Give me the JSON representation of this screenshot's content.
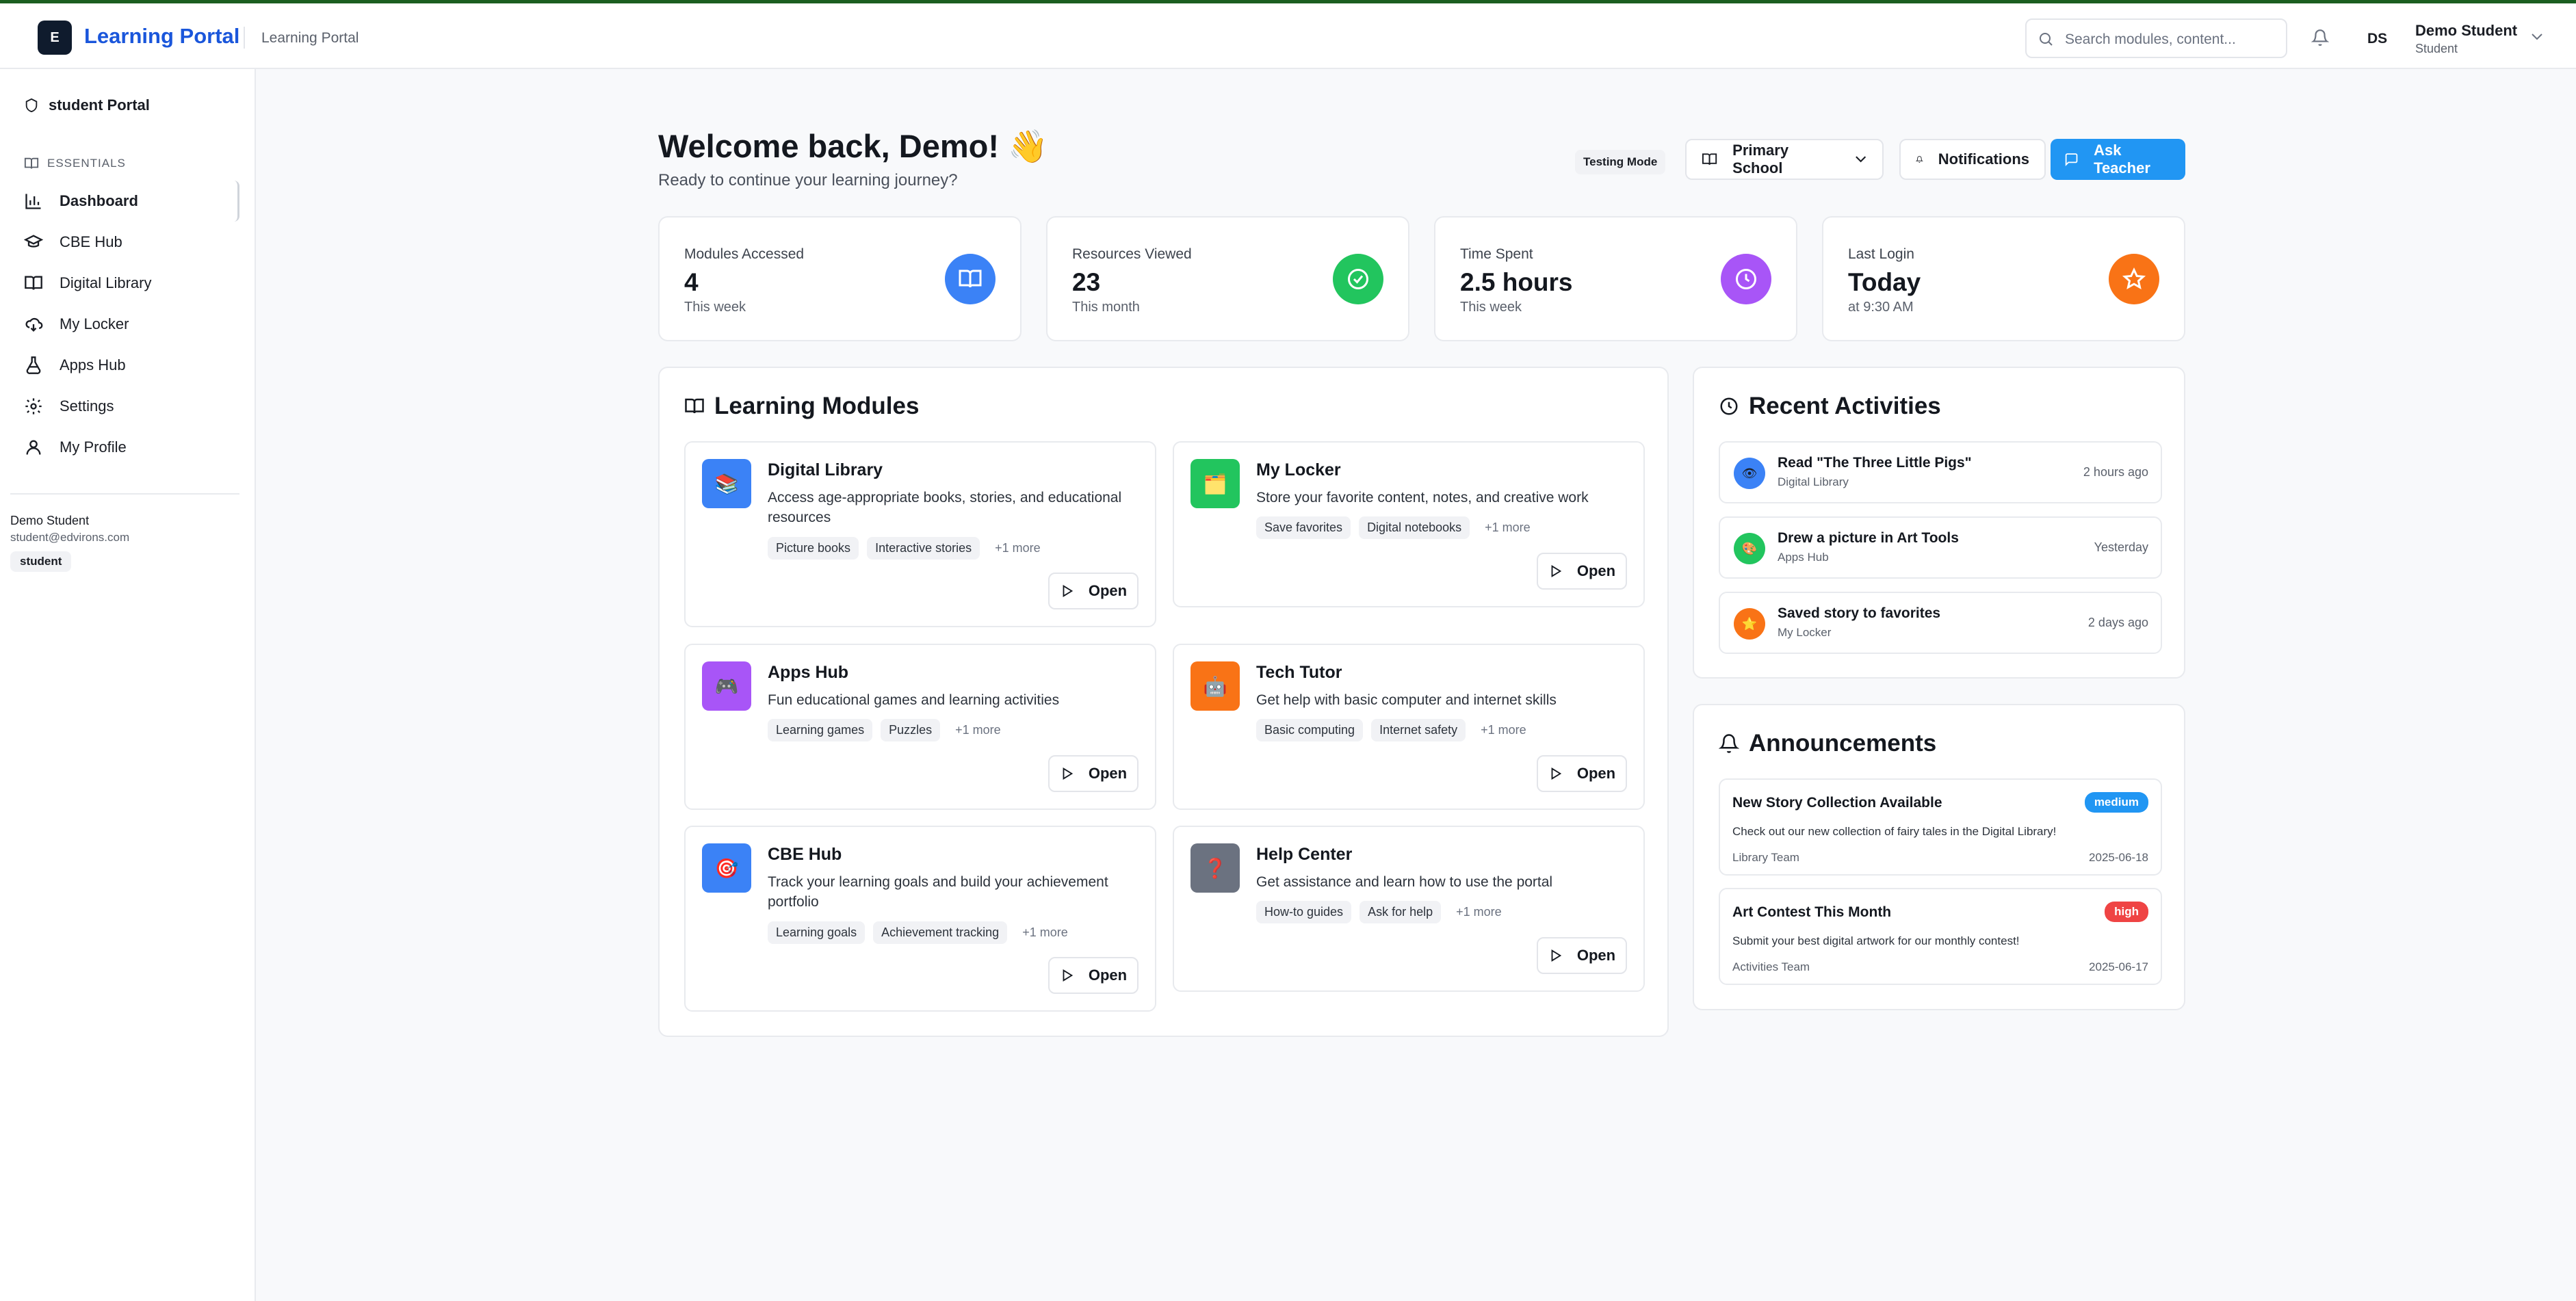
{
  "header": {
    "logo_letter": "E",
    "brand": "Learning Portal",
    "subtitle": "Learning Portal",
    "search_placeholder": "Search modules, content...",
    "initials": "DS",
    "user_name": "Demo Student",
    "user_role": "Student"
  },
  "sidebar": {
    "portal_title": "student Portal",
    "section_label": "ESSENTIALS",
    "items": [
      {
        "label": "Dashboard",
        "icon": "bar-chart-icon"
      },
      {
        "label": "CBE Hub",
        "icon": "graduation-cap-icon"
      },
      {
        "label": "Digital Library",
        "icon": "book-icon"
      },
      {
        "label": "My Locker",
        "icon": "cloud-download-icon"
      },
      {
        "label": "Apps Hub",
        "icon": "flask-icon"
      },
      {
        "label": "Settings",
        "icon": "gear-icon"
      },
      {
        "label": "My Profile",
        "icon": "user-icon"
      }
    ],
    "user_name": "Demo Student",
    "user_email": "student@edvirons.com",
    "user_badge": "student"
  },
  "main": {
    "welcome": "Welcome back, Demo! 👋",
    "welcome_sub": "Ready to continue your learning journey?",
    "testing_mode": "Testing Mode",
    "level_select": "Primary School",
    "notifications_label": "Notifications",
    "ask_teacher_label": "Ask Teacher"
  },
  "stats": [
    {
      "label": "Modules Accessed",
      "value": "4",
      "sub": "This week",
      "color": "#3b82f6",
      "icon": "book-icon"
    },
    {
      "label": "Resources Viewed",
      "value": "23",
      "sub": "This month",
      "color": "#22c55e",
      "icon": "check-circle-icon"
    },
    {
      "label": "Time Spent",
      "value": "2.5 hours",
      "sub": "This week",
      "color": "#a855f7",
      "icon": "clock-icon"
    },
    {
      "label": "Last Login",
      "value": "Today",
      "sub": "at 9:30 AM",
      "color": "#f97316",
      "icon": "star-icon"
    }
  ],
  "modules": {
    "title": "Learning Modules",
    "open_label": "Open",
    "items": [
      {
        "title": "Digital Library",
        "desc": "Access age-appropriate books, stories, and educational resources",
        "tags": [
          "Picture books",
          "Interactive stories"
        ],
        "more": "+1 more",
        "color": "#3b82f6",
        "emoji": "📚"
      },
      {
        "title": "My Locker",
        "desc": "Store your favorite content, notes, and creative work",
        "tags": [
          "Save favorites",
          "Digital notebooks"
        ],
        "more": "+1 more",
        "color": "#22c55e",
        "emoji": "🗂️"
      },
      {
        "title": "Apps Hub",
        "desc": "Fun educational games and learning activities",
        "tags": [
          "Learning games",
          "Puzzles"
        ],
        "more": "+1 more",
        "color": "#a855f7",
        "emoji": "🎮"
      },
      {
        "title": "Tech Tutor",
        "desc": "Get help with basic computer and internet skills",
        "tags": [
          "Basic computing",
          "Internet safety"
        ],
        "more": "+1 more",
        "color": "#f97316",
        "emoji": "🤖"
      },
      {
        "title": "CBE Hub",
        "desc": "Track your learning goals and build your achievement portfolio",
        "tags": [
          "Learning goals",
          "Achievement tracking"
        ],
        "more": "+1 more",
        "color": "#3b82f6",
        "emoji": "🎯"
      },
      {
        "title": "Help Center",
        "desc": "Get assistance and learn how to use the portal",
        "tags": [
          "How-to guides",
          "Ask for help"
        ],
        "more": "+1 more",
        "color": "#6b7280",
        "emoji": "❓"
      }
    ]
  },
  "activities": {
    "title": "Recent Activities",
    "items": [
      {
        "title": "Read \"The Three Little Pigs\"",
        "source": "Digital Library",
        "time": "2 hours ago",
        "color": "#3b82f6",
        "emoji": "👁"
      },
      {
        "title": "Drew a picture in Art Tools",
        "source": "Apps Hub",
        "time": "Yesterday",
        "color": "#22c55e",
        "emoji": "🎨"
      },
      {
        "title": "Saved story to favorites",
        "source": "My Locker",
        "time": "2 days ago",
        "color": "#f97316",
        "emoji": "⭐"
      }
    ]
  },
  "announcements": {
    "title": "Announcements",
    "items": [
      {
        "title": "New Story Collection Available",
        "badge": "medium",
        "badge_color": "#2196f3",
        "desc": "Check out our new collection of fairy tales in the Digital Library!",
        "from": "Library Team",
        "date": "2025-06-18"
      },
      {
        "title": "Art Contest This Month",
        "badge": "high",
        "badge_color": "#ef4444",
        "desc": "Submit your best digital artwork for our monthly contest!",
        "from": "Activities Team",
        "date": "2025-06-17"
      }
    ]
  }
}
